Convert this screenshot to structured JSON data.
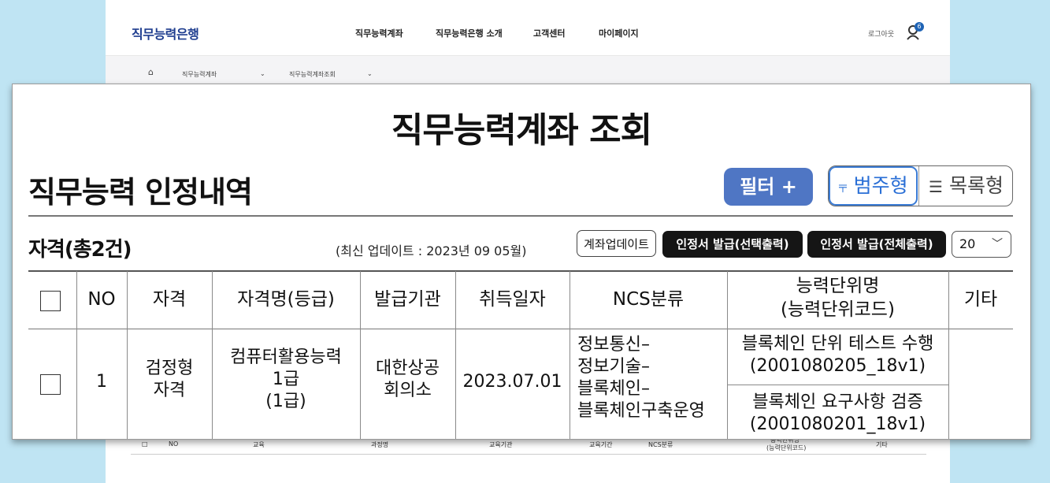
{
  "background": {
    "logo": "직무능력은행",
    "nav": [
      "직무능력계좌",
      "직무능력은행 소개",
      "고객센터",
      "마이페이지"
    ],
    "logout": "로그아웃",
    "badge": "6",
    "breadcrumb": [
      "직무능력계좌",
      "직무능력계좌조회"
    ],
    "edu_table_headers": [
      "NO",
      "교육",
      "과정명",
      "교육기관",
      "교육기간",
      "NCS분류",
      "능력단위명",
      "(능력단위코드)",
      "기타"
    ]
  },
  "page_title": "직무능력계좌 조회",
  "section_title": "직무능력 인정내역",
  "filter_button": "필터 +",
  "view": {
    "category": "범주형",
    "list": "목록형",
    "selected": "범주형"
  },
  "qual": {
    "count_title": "자격(총2건)",
    "update_note": "(최신 업데이트 : 2023년 09 05월)",
    "btn_update": "계좌업데이트",
    "btn_issue_selected": "인정서 발급(선택출력)",
    "btn_issue_all": "인정서 발급(전체출력)",
    "page_size": "20"
  },
  "table": {
    "headers": {
      "no": "NO",
      "type": "자격",
      "name": "자격명(등급)",
      "issuer": "발급기관",
      "date": "취득일자",
      "ncs": "NCS분류",
      "unit_line1": "능력단위명",
      "unit_line2": "(능력단위코드)",
      "etc": "기타"
    },
    "rows": [
      {
        "no": "1",
        "type": [
          "검정형",
          "자격"
        ],
        "name": [
          "컴퓨터활용능력",
          "1급",
          "(1급)"
        ],
        "issuer": [
          "대한상공",
          "회의소"
        ],
        "date": "2023.07.01",
        "ncs": [
          "정보통신–",
          "정보기술–",
          "블록체인–",
          "블록체인구축운영"
        ],
        "units": [
          {
            "name": "블록체인 단위 테스트 수행",
            "code": "(2001080205_18v1)"
          },
          {
            "name": "블록체인 요구사항 검증",
            "code": "(2001080201_18v1)"
          }
        ],
        "etc": ""
      }
    ]
  }
}
